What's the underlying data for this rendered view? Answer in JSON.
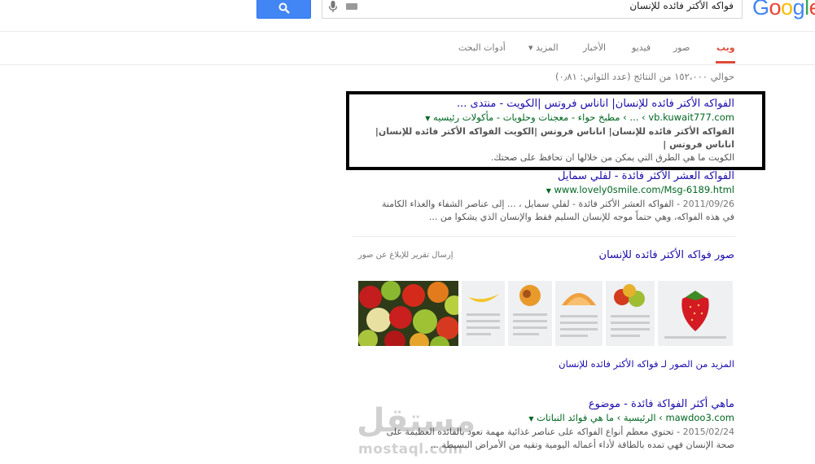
{
  "brand": {
    "logo_text": "Google"
  },
  "search": {
    "query": "فواكه الأكتر فائده للإنسان"
  },
  "tabs": [
    {
      "label": "ويب",
      "active": true
    },
    {
      "label": "صور"
    },
    {
      "label": "فيديو"
    },
    {
      "label": "الأخبار"
    },
    {
      "label": "المزيد ▾"
    },
    {
      "label": "أدوات البحث"
    }
  ],
  "result_stats": "حوالي ١٥٢،٠٠٠ من النتائج (عدد الثواني: ٠٫٨١)",
  "results": [
    {
      "title": "الفواكه الأكتر فائده للإنسان| اناناس فروتس |الكويت - منتدى ...",
      "url": "vb.kuwait777.com",
      "breadcrumb": "› ... › مطبخ حواء - معجنات وحلويات - مأكولات رئيسيه",
      "snippet_1": "الفواكه الأكتر فائده للإنسان| اناناس فروتس |الكويت الفواكه الأكتر فائده للإنسان| اناناس فروتس |",
      "snippet_2": "الكويت ما هي الطرق التي يمكن من خلالها ان تحافظ على صحتك."
    },
    {
      "title": "الفواكه العشر الأكثر فائدة - لفلي سمايل",
      "url": "www.lovely0smile.com/Msg-6189.html",
      "date": "2011/09/26",
      "snippet_1": "- الفواكه العشر الأكثر فائدة - لفلي سمايل ، ... إلى عناصر الشفاء والغذاء الكامنة",
      "snippet_2": "في هذه الفواكه، وهي حتماً موجه للإنسان السليم فقط والإنسان الذي يشكوا من ..."
    },
    {
      "title": "ماهي أكثر الفواكة فائدة - موضوع",
      "url": "mawdoo3.com",
      "breadcrumb": "› الرئيسية › ما هي فوائد النباتات",
      "date": "2015/02/24",
      "snippet_1": "- تحتوي معظم أنواع الفواكه على عناصر غذائية مهمة تعود بالفائدة العظيمة على",
      "snippet_2": "صحة الإنسان فهي تمده بالطاقة لأداء أعماله اليومية وتقيه من الأمراض البسيطة ..."
    }
  ],
  "images": {
    "title": "صور فواكه الأكتر فائده للإنسان",
    "report": "إرسال تقرير للإبلاغ عن صور",
    "more": "المزيد من الصور لـ فواكه الأكتر فائده للإنسان"
  },
  "watermark": {
    "ar": "مستقل",
    "en": "mostaql.com"
  },
  "colors": {
    "link": "#1a0dab",
    "url": "#006621",
    "accent": "#dd4b39",
    "button": "#4285f4"
  }
}
